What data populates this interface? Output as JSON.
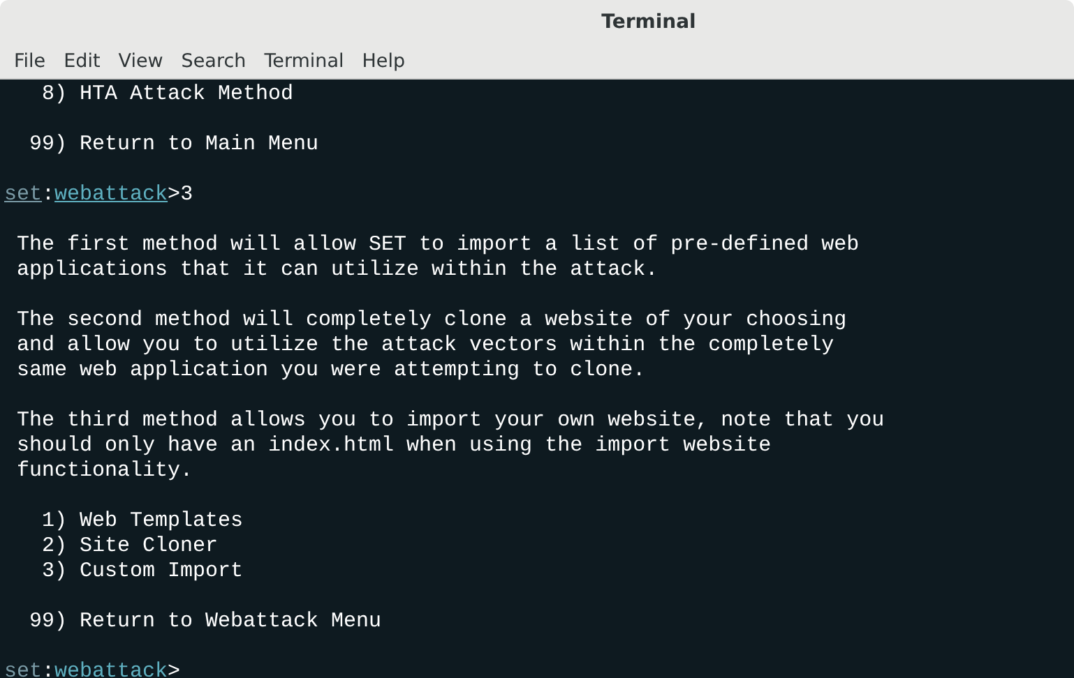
{
  "window": {
    "title": "Terminal"
  },
  "menu": [
    "File",
    "Edit",
    "View",
    "Search",
    "Terminal",
    "Help"
  ],
  "lines": [
    {
      "kind": "text",
      "text": "   8) HTA Attack Method"
    },
    {
      "kind": "blank"
    },
    {
      "kind": "text",
      "text": "  99) Return to Main Menu"
    },
    {
      "kind": "blank"
    },
    {
      "kind": "prompt",
      "name": "set",
      "separator": ":",
      "module": "webattack",
      "symbol": ">",
      "input": "3"
    },
    {
      "kind": "blank"
    },
    {
      "kind": "text",
      "text": " The first method will allow SET to import a list of pre-defined web"
    },
    {
      "kind": "text",
      "text": " applications that it can utilize within the attack."
    },
    {
      "kind": "blank"
    },
    {
      "kind": "text",
      "text": " The second method will completely clone a website of your choosing"
    },
    {
      "kind": "text",
      "text": " and allow you to utilize the attack vectors within the completely"
    },
    {
      "kind": "text",
      "text": " same web application you were attempting to clone."
    },
    {
      "kind": "blank"
    },
    {
      "kind": "text",
      "text": " The third method allows you to import your own website, note that you"
    },
    {
      "kind": "text",
      "text": " should only have an index.html when using the import website"
    },
    {
      "kind": "text",
      "text": " functionality."
    },
    {
      "kind": "blank"
    },
    {
      "kind": "text",
      "text": "   1) Web Templates"
    },
    {
      "kind": "text",
      "text": "   2) Site Cloner"
    },
    {
      "kind": "text",
      "text": "   3) Custom Import"
    },
    {
      "kind": "blank"
    },
    {
      "kind": "text",
      "text": "  99) Return to Webattack Menu"
    },
    {
      "kind": "blank"
    },
    {
      "kind": "prompt",
      "name": "set",
      "separator": ":",
      "module": "webattack",
      "symbol": ">"
    }
  ]
}
